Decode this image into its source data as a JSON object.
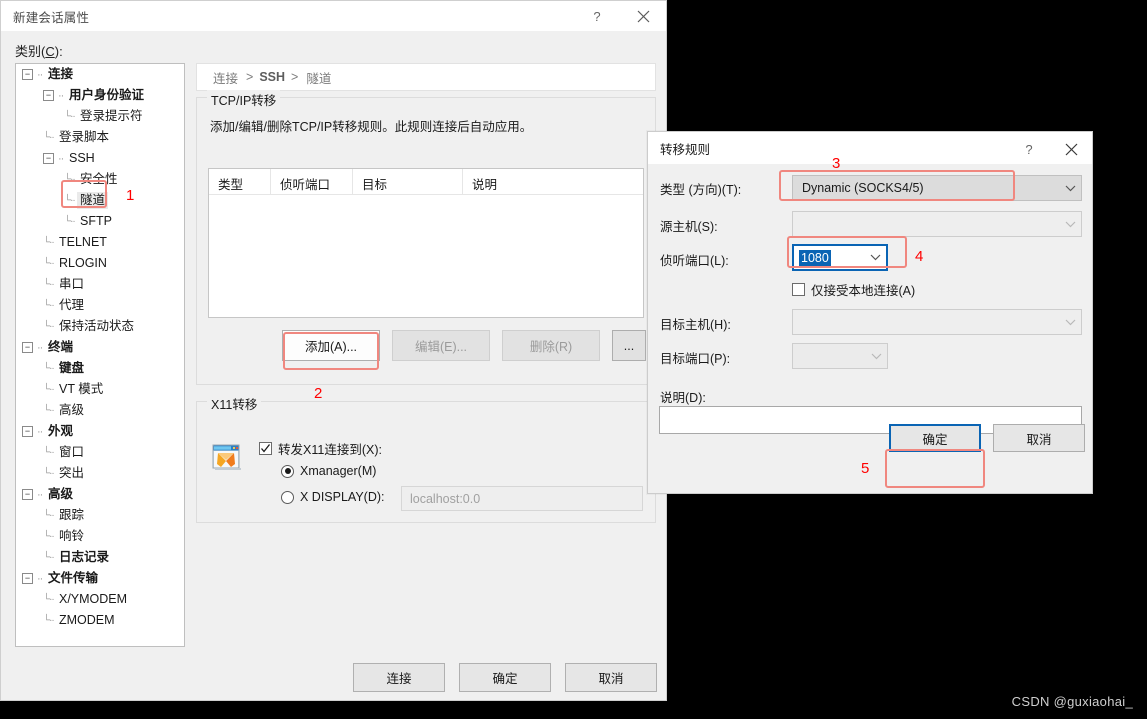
{
  "main_window": {
    "title": "新建会话属性",
    "help_icon": "question-mark-icon",
    "close_icon": "close-icon",
    "category_label": "类别(C):",
    "tree": [
      {
        "label": "连接",
        "level": 0,
        "bold": true,
        "toggle": "minus",
        "selected": false
      },
      {
        "label": "用户身份验证",
        "level": 1,
        "bold": true,
        "toggle": "minus",
        "selected": false
      },
      {
        "label": "登录提示符",
        "level": 2,
        "bold": false,
        "toggle": "none",
        "selected": false
      },
      {
        "label": "登录脚本",
        "level": 1,
        "bold": false,
        "toggle": "none",
        "selected": false
      },
      {
        "label": "SSH",
        "level": 1,
        "bold": false,
        "toggle": "minus",
        "selected": false
      },
      {
        "label": "安全性",
        "level": 2,
        "bold": false,
        "toggle": "none",
        "selected": false
      },
      {
        "label": "隧道",
        "level": 2,
        "bold": false,
        "toggle": "none",
        "selected": true
      },
      {
        "label": "SFTP",
        "level": 2,
        "bold": false,
        "toggle": "none",
        "selected": false
      },
      {
        "label": "TELNET",
        "level": 1,
        "bold": false,
        "toggle": "none",
        "selected": false
      },
      {
        "label": "RLOGIN",
        "level": 1,
        "bold": false,
        "toggle": "none",
        "selected": false
      },
      {
        "label": "串口",
        "level": 1,
        "bold": false,
        "toggle": "none",
        "selected": false
      },
      {
        "label": "代理",
        "level": 1,
        "bold": false,
        "toggle": "none",
        "selected": false
      },
      {
        "label": "保持活动状态",
        "level": 1,
        "bold": false,
        "toggle": "none",
        "selected": false
      },
      {
        "label": "终端",
        "level": 0,
        "bold": true,
        "toggle": "minus",
        "selected": false
      },
      {
        "label": "键盘",
        "level": 1,
        "bold": true,
        "toggle": "none",
        "selected": false
      },
      {
        "label": "VT 模式",
        "level": 1,
        "bold": false,
        "toggle": "none",
        "selected": false
      },
      {
        "label": "高级",
        "level": 1,
        "bold": false,
        "toggle": "none",
        "selected": false
      },
      {
        "label": "外观",
        "level": 0,
        "bold": true,
        "toggle": "minus",
        "selected": false
      },
      {
        "label": "窗口",
        "level": 1,
        "bold": false,
        "toggle": "none",
        "selected": false
      },
      {
        "label": "突出",
        "level": 1,
        "bold": false,
        "toggle": "none",
        "selected": false
      },
      {
        "label": "高级",
        "level": 0,
        "bold": true,
        "toggle": "minus",
        "selected": false
      },
      {
        "label": "跟踪",
        "level": 1,
        "bold": false,
        "toggle": "none",
        "selected": false
      },
      {
        "label": "响铃",
        "level": 1,
        "bold": false,
        "toggle": "none",
        "selected": false
      },
      {
        "label": "日志记录",
        "level": 1,
        "bold": true,
        "toggle": "none",
        "selected": false
      },
      {
        "label": "文件传输",
        "level": 0,
        "bold": true,
        "toggle": "minus",
        "selected": false
      },
      {
        "label": "X/YMODEM",
        "level": 1,
        "bold": false,
        "toggle": "none",
        "selected": false
      },
      {
        "label": "ZMODEM",
        "level": 1,
        "bold": false,
        "toggle": "none",
        "selected": false
      }
    ],
    "breadcrumb": {
      "first": "连接",
      "sep1": ">",
      "second": "SSH",
      "sep2": ">",
      "third": "隧道"
    },
    "tcp_group": {
      "legend": "TCP/IP转移",
      "description": "添加/编辑/删除TCP/IP转移规则。此规则连接后自动应用。",
      "columns": [
        "类型",
        "侦听端口",
        "目标",
        "说明"
      ],
      "rows": [],
      "buttons": {
        "add": "添加(A)...",
        "edit": "编辑(E)...",
        "delete": "删除(R)",
        "more": "..."
      }
    },
    "x11_group": {
      "legend": "X11转移",
      "icon": "xmanager-icon",
      "forward_checkbox": "转发X11连接到(X):",
      "forward_checked": true,
      "radio_xmanager": "Xmanager(M)",
      "radio_xmanager_selected": true,
      "radio_xdisplay": "X DISPLAY(D):",
      "radio_xdisplay_selected": false,
      "xdisplay_value": "localhost:0.0"
    },
    "bottom_buttons": [
      "连接",
      "确定",
      "取消"
    ]
  },
  "rule_dialog": {
    "title": "转移规则",
    "help_icon": "question-mark-icon",
    "close_icon": "close-icon",
    "fields": {
      "type_label": "类型 (方向)(T):",
      "type_value": "Dynamic (SOCKS4/5)",
      "source_host_label": "源主机(S):",
      "source_host_value": "",
      "listen_port_label": "侦听端口(L):",
      "listen_port_value": "1080",
      "local_only_label": "仅接受本地连接(A)",
      "local_only_checked": false,
      "dest_host_label": "目标主机(H):",
      "dest_host_value": "",
      "dest_port_label": "目标端口(P):",
      "dest_port_value": "",
      "desc_label": "说明(D):",
      "desc_value": ""
    },
    "buttons": {
      "ok": "确定",
      "cancel": "取消"
    }
  },
  "annotations": {
    "colors": {
      "box": "#f0877f",
      "number": "#ff0000"
    },
    "markers": [
      {
        "number": "1",
        "target": "tree-item-隧道"
      },
      {
        "number": "2",
        "target": "add-button"
      },
      {
        "number": "3",
        "target": "type-combobox"
      },
      {
        "number": "4",
        "target": "listen-port-combobox"
      },
      {
        "number": "5",
        "target": "ok-button"
      }
    ]
  },
  "watermark": "CSDN @guxiaohai_"
}
